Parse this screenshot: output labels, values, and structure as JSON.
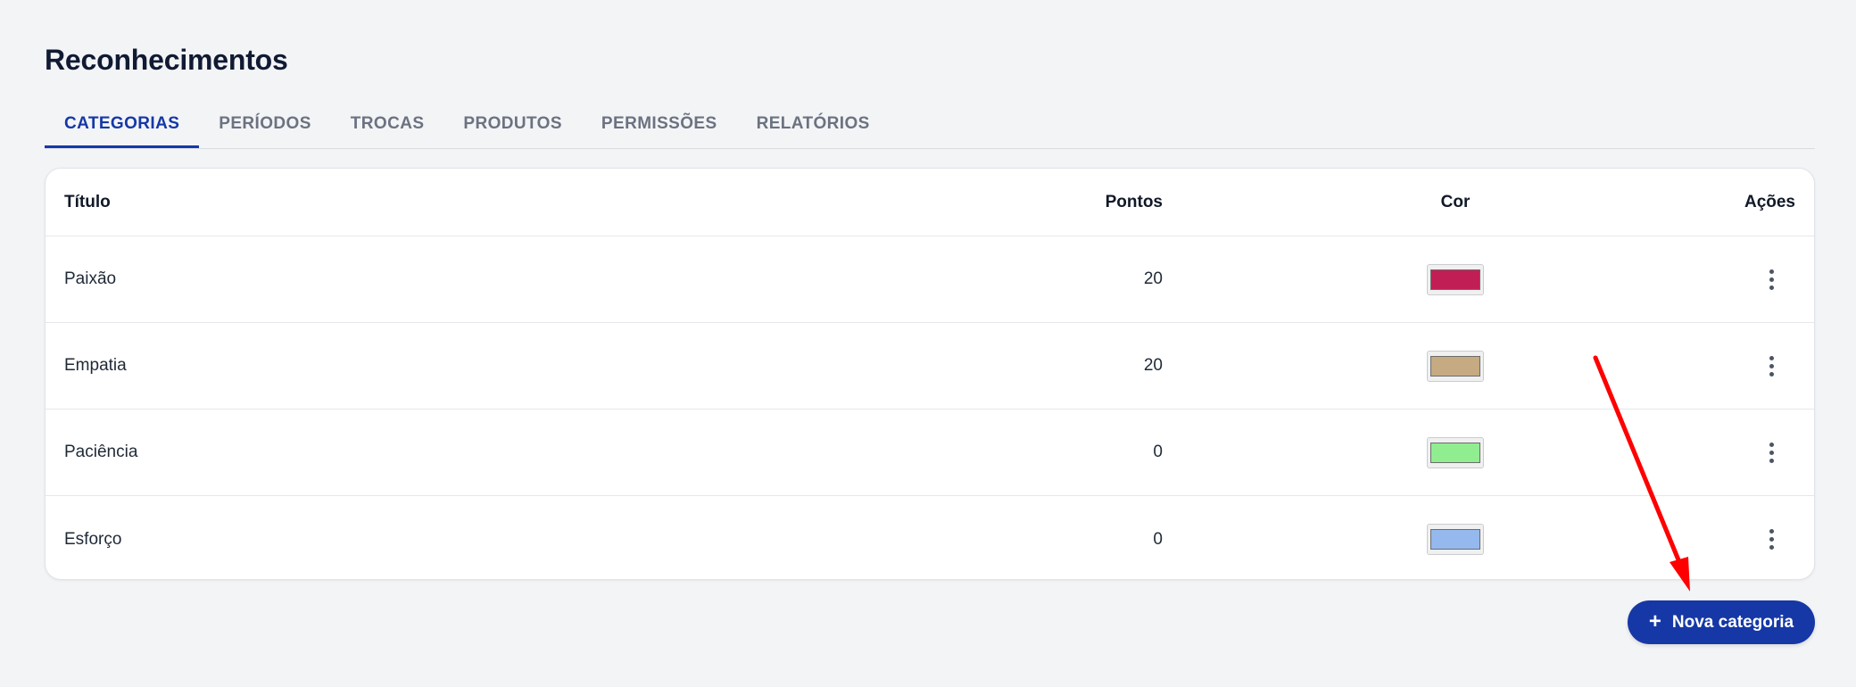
{
  "page": {
    "title": "Reconhecimentos"
  },
  "tabs": [
    {
      "label": "CATEGORIAS",
      "active": true
    },
    {
      "label": "PERÍODOS",
      "active": false
    },
    {
      "label": "TROCAS",
      "active": false
    },
    {
      "label": "PRODUTOS",
      "active": false
    },
    {
      "label": "PERMISSÕES",
      "active": false
    },
    {
      "label": "RELATÓRIOS",
      "active": false
    }
  ],
  "table": {
    "headers": {
      "title": "Título",
      "points": "Pontos",
      "color": "Cor",
      "actions": "Ações"
    },
    "rows": [
      {
        "title": "Paixão",
        "points": "20",
        "color": "#c21e56"
      },
      {
        "title": "Empatia",
        "points": "20",
        "color": "#c6aa82"
      },
      {
        "title": "Paciência",
        "points": "0",
        "color": "#90ee90"
      },
      {
        "title": "Esforço",
        "points": "0",
        "color": "#95b9ee"
      }
    ]
  },
  "actions": {
    "new_category_label": "Nova categoria"
  },
  "icons": {
    "row_menu": "kebab-menu-icon",
    "add": "plus-icon",
    "annotation": "red-arrow"
  },
  "colors": {
    "accent": "#1638a6",
    "background": "#f3f4f6",
    "annotation_arrow": "#ff0000"
  }
}
